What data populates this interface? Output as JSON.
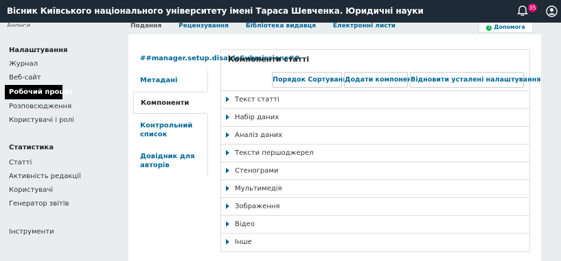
{
  "header": {
    "title": "Вісник Київського національного університету імені Тараса Шевченка. Юридичні науки",
    "notification_count": "35"
  },
  "sidebar": {
    "clipped_item": "Анонси",
    "settings_title": "Налаштування",
    "settings_items": [
      "Журнал",
      "Веб-сайт",
      "Робочий процес",
      "Розповсюдження",
      "Користувачі і ролі"
    ],
    "stats_title": "Статистика",
    "stats_items": [
      "Статті",
      "Активність редакції",
      "Користувачі",
      "Генератор звітів"
    ],
    "tools": "Інструменти"
  },
  "tabs": [
    "Подання",
    "Рецензування",
    "Бібліотека видавця",
    "Електронні листи"
  ],
  "help_label": "Допомога",
  "vertical_tabs": [
    "##manager.setup.disableSubmissions##",
    "Метадані",
    "Компоненти",
    "Контрольний список",
    "Довідник для авторів"
  ],
  "panel": {
    "title": "Компоненти статті",
    "buttons": [
      "Порядок Сортування",
      "Додати компонент",
      "Відновити усталені налаштування"
    ],
    "components": [
      "Текст статті",
      "Набір даних",
      "Аналіз даних",
      "Тексти першоджерел",
      "Стенограми",
      "Мультимедія",
      "Зображення",
      "Відео",
      "Інше"
    ]
  }
}
